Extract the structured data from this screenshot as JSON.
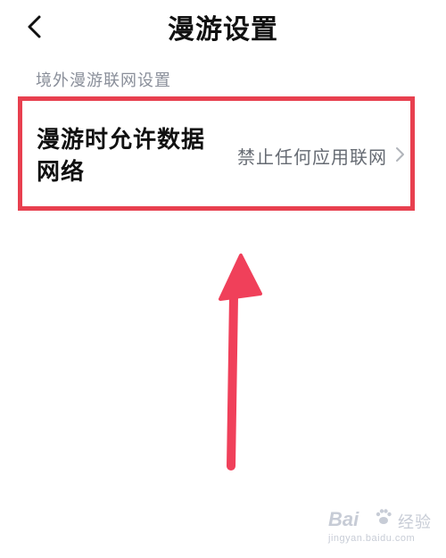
{
  "header": {
    "title": "漫游设置",
    "back_icon": "chevron-left-icon"
  },
  "section": {
    "label": "境外漫游联网设置"
  },
  "setting": {
    "label": "漫游时允许数据网络",
    "value": "禁止任何应用联网",
    "chevron_icon": "chevron-right-icon"
  },
  "annotation": {
    "highlight_color": "#e8404f",
    "arrow_color": "#f0405a",
    "arrow_icon": "arrow-up-icon"
  },
  "watermark": {
    "logo_text": "Bai",
    "name": "经验",
    "url": "jingyan.baidu.com"
  }
}
